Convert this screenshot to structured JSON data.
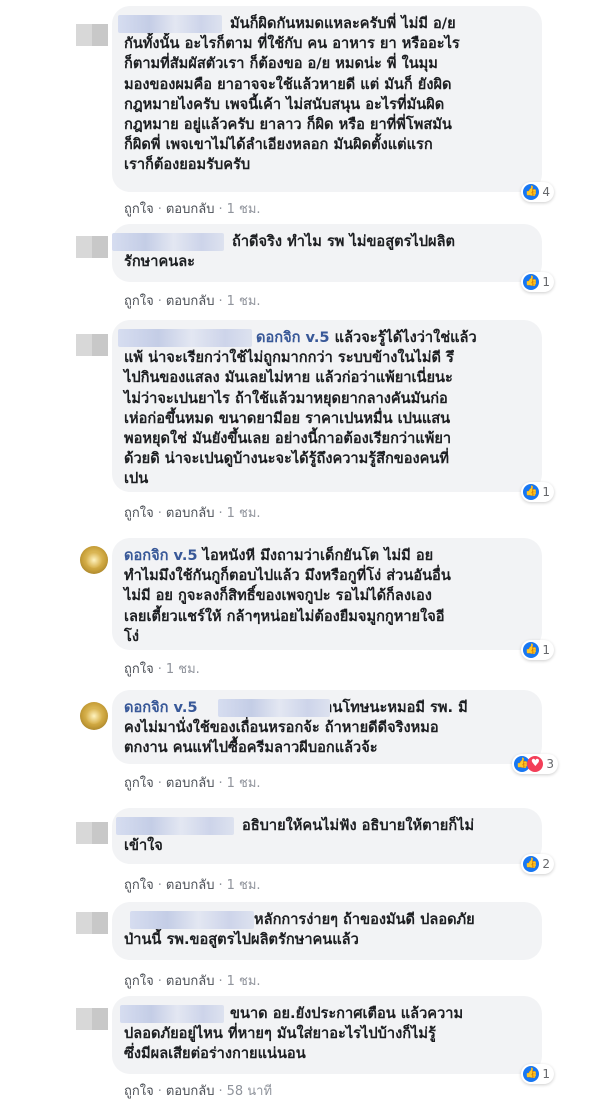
{
  "actions_labels": {
    "like": "ถูกใจ",
    "reply": "ตอบกลับ",
    "separator": "·"
  },
  "colors": {
    "bubble": "#f2f3f5",
    "name_link": "#385898",
    "like_blue": "#1877f2",
    "love_red": "#f33e58"
  },
  "comments": [
    {
      "text": "มันก็ผิดกันหมดแหละครับพี่ ไม่มี อ/ย\nกันทั้งนั้น อะไรก็ตาม ที่ใช้กับ คน อาหาร ยา หรืออะไร\nก็ตามที่สัมผัสตัวเรา ก็ต้องขอ อ/ย หมดน่ะ พี่ ในมุม\nมองของผมคือ ยาอาจจะใช้แล้วหายดี แต่ มันก็ ยังผิด\nกฎหมายไงครับ เพจนี้เค้า ไม่สนับสนุน อะไรที่มันผิด\nกฎหมาย อยู่แล้วครับ ยาลาว ก็ผิด หรือ ยาที่พี่โพสมัน\nก็ผิดพี่ เพจเขาไม่ได้ลำเอียงหลอก มันผิดตั้งแต่แรก\nเราก็ต้องยอมรับครับ",
      "time": "1 ชม.",
      "reaction_count": "4",
      "icons": [
        "like-icon"
      ]
    },
    {
      "text": "ถ้าดีจริง ทำไม รพ ไม่ขอสูตรไปผลิต\nรักษาคนละ",
      "time": "1 ชม.",
      "reaction_count": "1",
      "icons": [
        "like-icon"
      ]
    },
    {
      "author": "ดอกจิก v.5",
      "text": "แล้วจะรู้ได้ไงว่าใช่แล้ว\nแพ้ น่าจะเรียกว่าใช้ไม่ถูกมากกว่า ระบบข้างในไม่ดี รึ\nไปกินของแสลง มันเลยไม่หาย แล้วก่อว่าแพ้ยาเนี่ยนะ\nไม่ว่าจะเปนยาไร ถ้าใช้แล้วมาหยุดยากลางคันมันก่อ\nเห่อก่อขึ้นหมด ขนาดยามีอย ราคาเปนหมื่น เปนแสน\nพอหยุดใช่ มันยังขึ้นเลย อย่างนี้กาอต้องเรียกว่าแพ้ยา\nด้วยดิ น่าจะเปนดูบ้างนะจะได้รู้ถึงความรู้สึกของคนที่\nเปน",
      "time": "1 ชม.",
      "reaction_count": "1",
      "icons": [
        "like-icon"
      ]
    },
    {
      "author": "ดอกจิก v.5",
      "text": "ไอหนังหี มึงถามว่าเด็กยันโต ไม่มี อย\nทำไมมึงใช้กันกูก็ตอบไปแล้ว มึงหรือกูที่โง่ ส่วนอันอื่น\nไม่มี อย กูจะลงก็สิทธิ์ของเพจกูปะ รอไม่ได้ก็ลงเอง\nเลยเตี้ยวแชร์ให้ กล้าๆหน่อยไม่ต้องยืมจมูกกูหายใจอี\nโง่",
      "time": "1 ชม.",
      "reaction_count": "1",
      "icons": [
        "like-icon"
      ]
    },
    {
      "author": "ดอกจิก v.5",
      "text": "ทานโทษนะหมอมี รพ. มี\nคงไม่มานั่งใช้ของเถื่อนหรอกจ้ะ ถ้าหายดีดีจริงหมอ\nตกงาน คนแห่ไปซื้อครีมลาวผีบอกแล้วจ้ะ",
      "time": "1 ชม.",
      "reaction_count": "3",
      "icons": [
        "like-icon",
        "love-icon"
      ]
    },
    {
      "text": "อธิบายให้คนไม่ฟัง อธิบายให้ตายก็ไม่\nเข้าใจ",
      "time": "1 ชม.",
      "reaction_count": "2",
      "icons": [
        "like-icon"
      ]
    },
    {
      "text": "หลักการง่ายๆ ถ้าของมันดี ปลอดภัย\nป่านนี้ รพ.ขอสูตรไปผลิตรักษาคนแล้ว",
      "time": "1 ชม.",
      "reaction_count": "",
      "icons": []
    },
    {
      "text": "ขนาด อย.ยังประกาศเตือน แล้วความ\nปลอดภัยอยู่ไหน ที่หายๆ มันใส่ยาอะไรไปบ้างก็ไม่รู้\nซึ่งมีผลเสียต่อร่างกายแน่นอน",
      "time": "58 นาที",
      "reaction_count": "1",
      "icons": [
        "like-icon"
      ]
    }
  ]
}
